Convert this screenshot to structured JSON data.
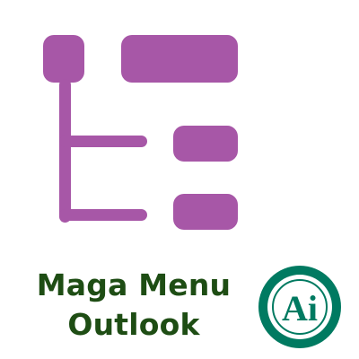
{
  "title": {
    "line1": "Maga Menu",
    "line2": "Outlook"
  },
  "logo": {
    "text": "Ai",
    "icon": "ai-badge-icon",
    "ring_color": "#007a61",
    "fill_color": "#ffffff"
  },
  "graphic": {
    "icon": "tree-menu-icon",
    "color": "#a757a7"
  }
}
